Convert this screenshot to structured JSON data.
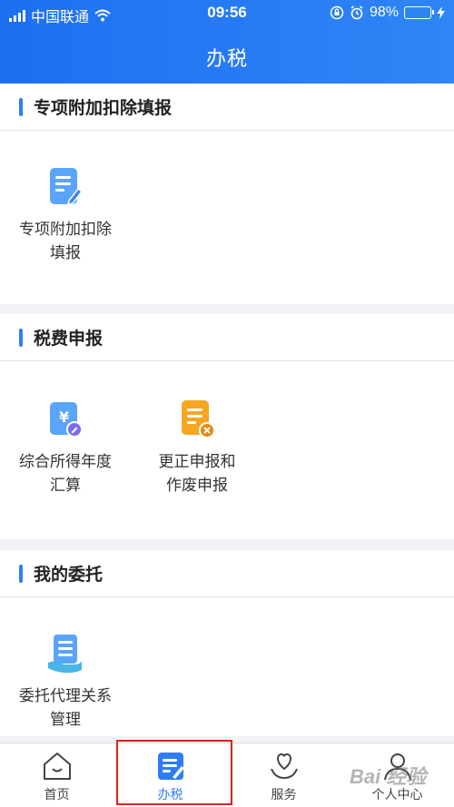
{
  "status_bar": {
    "carrier": "中国联通",
    "time": "09:56",
    "battery": "98%"
  },
  "nav": {
    "title": "办税"
  },
  "sections": [
    {
      "title": "专项附加扣除填报",
      "items": [
        {
          "line1": "专项附加扣除",
          "line2": "填报",
          "icon": "form-edit-icon"
        }
      ]
    },
    {
      "title": "税费申报",
      "items": [
        {
          "line1": "综合所得年度",
          "line2": "汇算",
          "icon": "yuan-document-icon"
        },
        {
          "line1": "更正申报和",
          "line2": "作废申报",
          "icon": "document-cancel-icon"
        }
      ]
    },
    {
      "title": "我的委托",
      "items": [
        {
          "line1": "委托代理关系",
          "line2": "管理",
          "icon": "hand-document-icon"
        }
      ]
    }
  ],
  "tabbar": {
    "items": [
      {
        "label": "首页",
        "icon": "home-icon"
      },
      {
        "label": "办税",
        "icon": "tax-document-icon",
        "active": true
      },
      {
        "label": "服务",
        "icon": "heart-hand-icon"
      },
      {
        "label": "个人中心",
        "icon": "person-icon"
      }
    ]
  },
  "watermark": "Bai 经验",
  "colors": {
    "accent": "#2f7df6",
    "header": "#1d6ff2",
    "highlight": "#e02020"
  }
}
